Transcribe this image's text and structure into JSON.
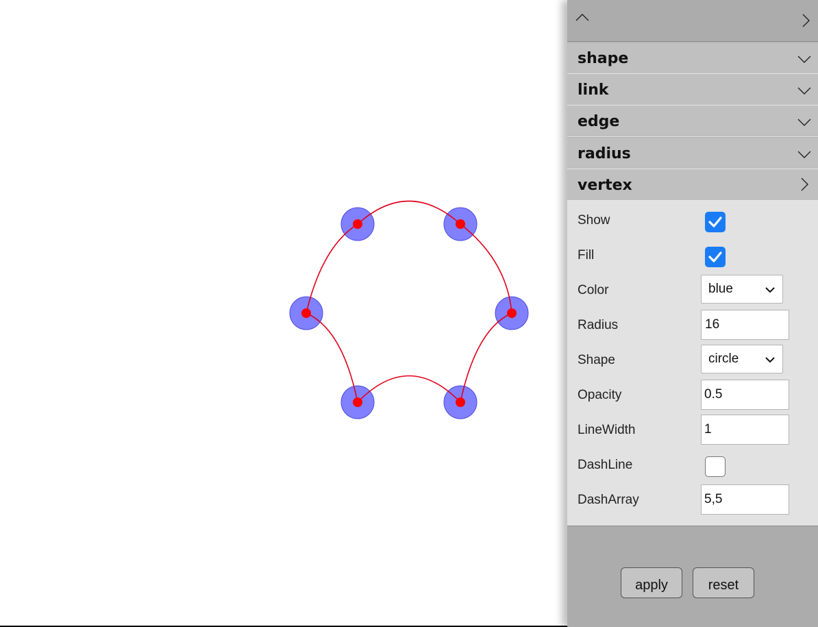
{
  "graph": {
    "vertex_fill_color": "#6b6bff",
    "vertex_stroke_color": "#4a4ae0",
    "vertex_opacity": 0.5,
    "center_dot_color": "#ff0000",
    "edge_color": "#e0001a"
  },
  "panel": {
    "top_icons": [
      "chevron-up-icon",
      "chevron-right-icon"
    ],
    "sections": [
      {
        "label": "shape",
        "icon": "chevron-down-icon"
      },
      {
        "label": "link",
        "icon": "chevron-down-icon"
      },
      {
        "label": "edge",
        "icon": "chevron-down-icon"
      },
      {
        "label": "radius",
        "icon": "chevron-down-icon"
      },
      {
        "label": "vertex",
        "icon": "chevron-right-icon"
      }
    ],
    "vertex": {
      "show_label": "Show",
      "show_checked": true,
      "fill_label": "Fill",
      "fill_checked": true,
      "color_label": "Color",
      "color_value": "blue",
      "radius_label": "Radius",
      "radius_value": "16",
      "shape_label": "Shape",
      "shape_value": "circle",
      "opacity_label": "Opacity",
      "opacity_value": "0.5",
      "linewidth_label": "LineWidth",
      "linewidth_value": "1",
      "dashline_label": "DashLine",
      "dashline_checked": false,
      "dasharray_label": "DashArray",
      "dasharray_value": "5,5"
    },
    "apply_label": "apply",
    "reset_label": "reset",
    "checkbox_color": "#1a7cf5"
  }
}
